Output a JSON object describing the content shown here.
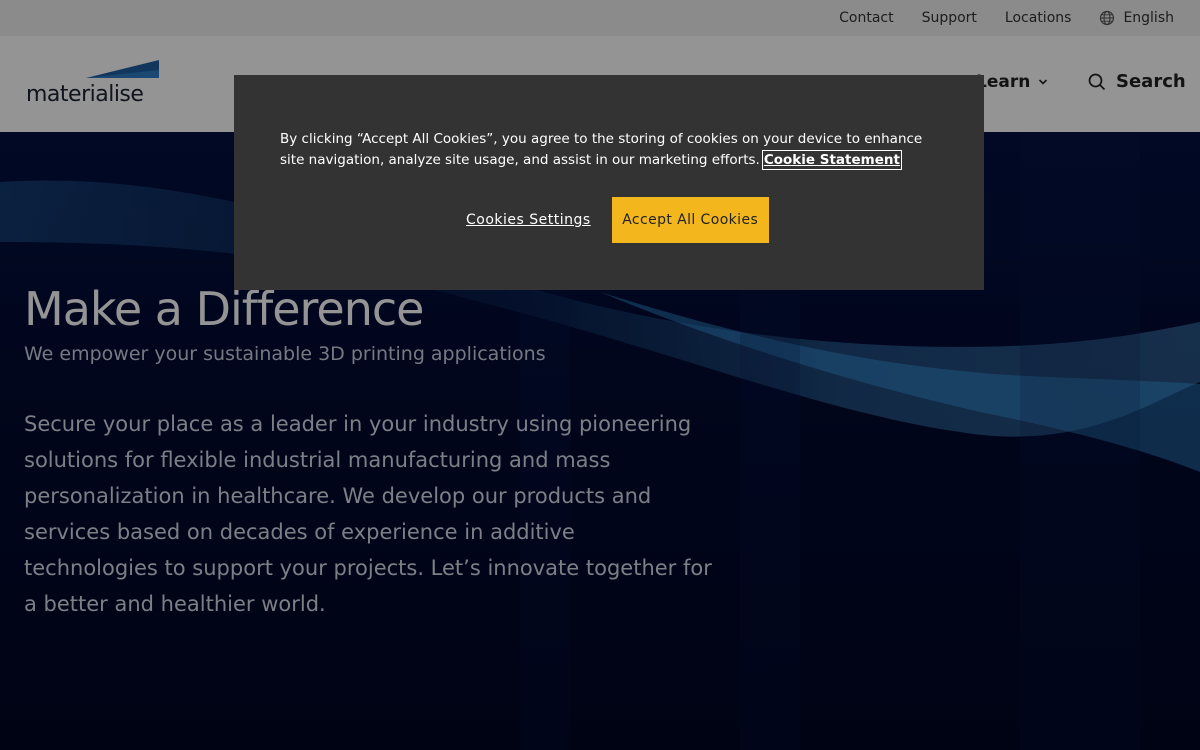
{
  "topbar": {
    "links": [
      "Contact",
      "Support",
      "Locations"
    ],
    "language": "English"
  },
  "header": {
    "logo_text": "materialise",
    "nav_learn": "Learn",
    "search_label": "Search"
  },
  "hero": {
    "title": "Make a Difference",
    "subtitle": "We empower your sustainable 3D printing applications",
    "body": "Secure your place as a leader in your industry using pioneering solutions for flexible industrial manufacturing and mass personalization in healthcare. We develop our products and services based on decades of experience in additive technologies to support your projects. Let’s innovate together for a better and healthier world."
  },
  "cookie": {
    "text": "By clicking “Accept All Cookies”, you agree to the storing of cookies on your device to enhance site navigation, analyze site usage, and assist in our marketing efforts.",
    "statement_link": "Cookie Statement",
    "settings_label": "Cookies Settings",
    "accept_label": "Accept All Cookies"
  },
  "colors": {
    "accent": "#f3b71d",
    "logo_blue": "#1f5fa3",
    "hero_bg": "#020a2a",
    "dialog_bg": "#333333"
  },
  "icons": [
    "globe-icon",
    "chevron-down-icon",
    "search-icon",
    "logo-wedge-icon"
  ]
}
